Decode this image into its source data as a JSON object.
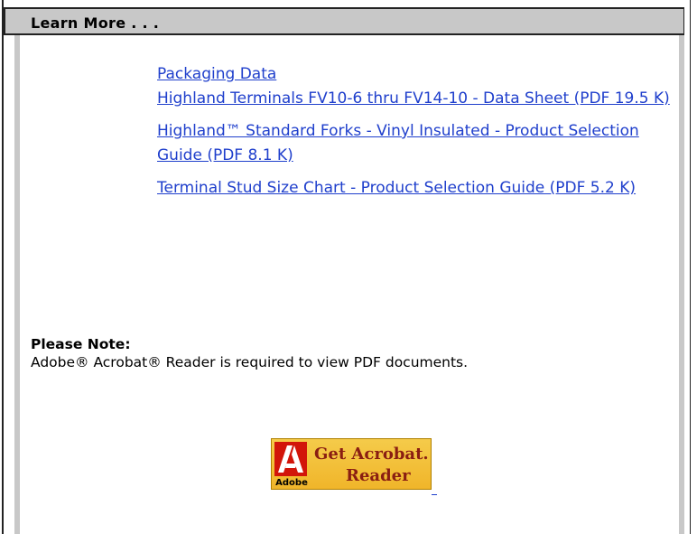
{
  "header": {
    "title": "Learn More . . ."
  },
  "links": [
    {
      "label": "Packaging Data"
    },
    {
      "label": "Highland Terminals FV10-6 thru FV14-10 - Data Sheet (PDF 19.5 K)"
    },
    {
      "label": "Highland™ Standard Forks - Vinyl Insulated - Product Selection Guide (PDF 8.1 K)"
    },
    {
      "label": "Terminal Stud Size Chart - Product Selection Guide (PDF 5.2 K)"
    }
  ],
  "note": {
    "title": "Please Note:",
    "text": "Adobe® Acrobat® Reader is required to view PDF documents."
  },
  "acrobat_badge": {
    "line1": "Get Acrobat.",
    "line2": "Reader",
    "brand": "Adobe",
    "icon": "adobe-logo-icon"
  },
  "colors": {
    "header_bg": "#c8c8c8",
    "link": "#1f3fcc",
    "badge_bg": "#f0b52a",
    "badge_text": "#8a1e12",
    "adobe_red": "#d2150a"
  }
}
